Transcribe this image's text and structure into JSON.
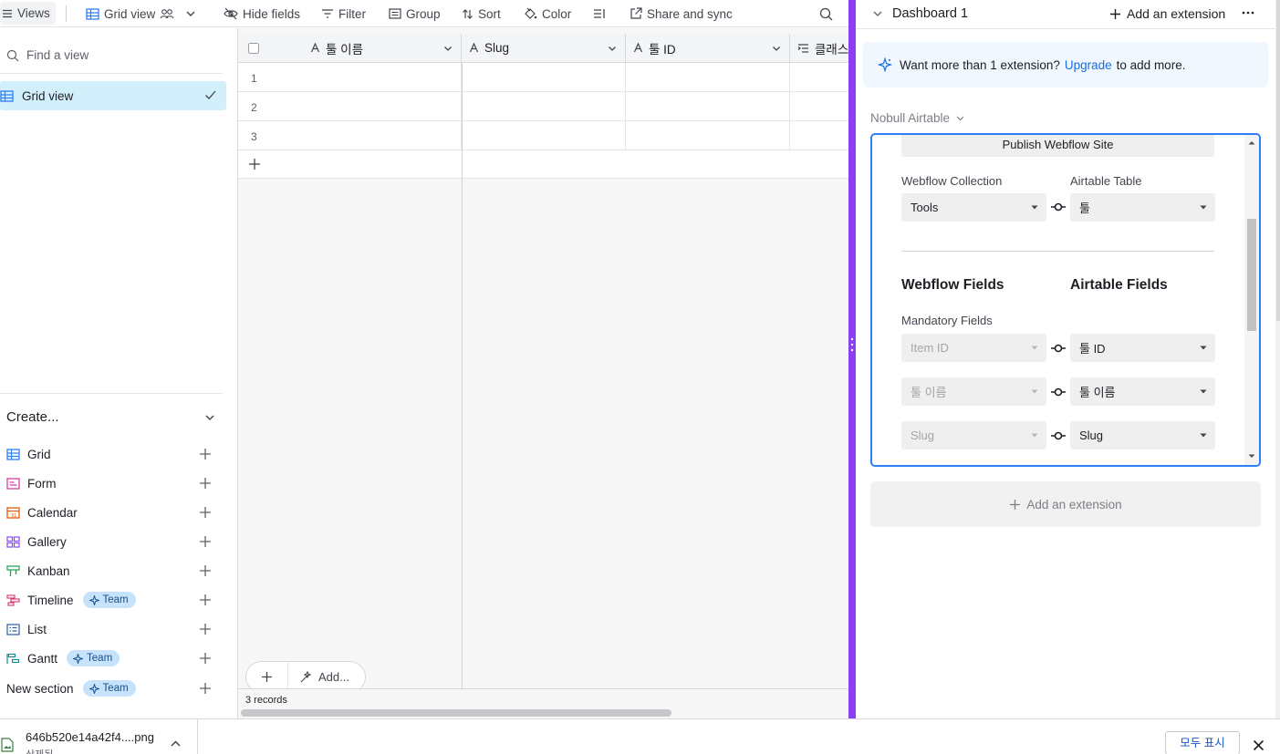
{
  "toolbar": {
    "views_label": "Views",
    "view_name": "Grid view",
    "hide_fields": "Hide fields",
    "filter": "Filter",
    "group": "Group",
    "sort": "Sort",
    "color": "Color",
    "share_sync": "Share and sync"
  },
  "sidebar": {
    "find_placeholder": "Find a view",
    "active_view": "Grid view",
    "create_label": "Create...",
    "create_items": [
      {
        "label": "Grid",
        "icon": "grid-icon",
        "color": "#2d7ff9"
      },
      {
        "label": "Form",
        "icon": "form-icon",
        "color": "#d63fa5"
      },
      {
        "label": "Calendar",
        "icon": "calendar-icon",
        "color": "#e8590c"
      },
      {
        "label": "Gallery",
        "icon": "gallery-icon",
        "color": "#8b46ff"
      },
      {
        "label": "Kanban",
        "icon": "kanban-icon",
        "color": "#20a35a"
      },
      {
        "label": "Timeline",
        "icon": "timeline-icon",
        "color": "#d6336c",
        "badge": "Team"
      },
      {
        "label": "List",
        "icon": "list-icon",
        "color": "#2d5fa8"
      },
      {
        "label": "Gantt",
        "icon": "gantt-icon",
        "color": "#0f8b8d",
        "badge": "Team"
      },
      {
        "label": "New section",
        "icon": "",
        "color": "",
        "badge": "Team"
      }
    ]
  },
  "grid": {
    "columns": [
      "툴 이름",
      "Slug",
      "툴 ID",
      "클래스"
    ],
    "rows": [
      "1",
      "2",
      "3"
    ],
    "add_label": "Add...",
    "records": "3 records"
  },
  "panel": {
    "dashboard_title": "Dashboard 1",
    "add_extension": "Add an extension",
    "upgrade_prefix": "Want more than 1 extension?",
    "upgrade_link": "Upgrade",
    "upgrade_suffix": "to add more.",
    "base_name": "Nobull Airtable",
    "publish_button": "Publish Webflow Site",
    "webflow_collection_label": "Webflow Collection",
    "airtable_table_label": "Airtable Table",
    "webflow_collection_value": "Tools",
    "airtable_table_value": "툴",
    "webflow_fields_heading": "Webflow Fields",
    "airtable_fields_heading": "Airtable Fields",
    "mandatory_label": "Mandatory Fields",
    "mappings": [
      {
        "webflow": "Item ID",
        "airtable": "툴 ID"
      },
      {
        "webflow": "툴 이름",
        "airtable": "툴 이름"
      },
      {
        "webflow": "Slug",
        "airtable": "Slug"
      }
    ],
    "add_extension_bottom": "Add an extension"
  },
  "downloads": {
    "file_name": "646b520e14a42f4....png",
    "file_sub": "삭제됨",
    "show_all": "모두 표시"
  }
}
